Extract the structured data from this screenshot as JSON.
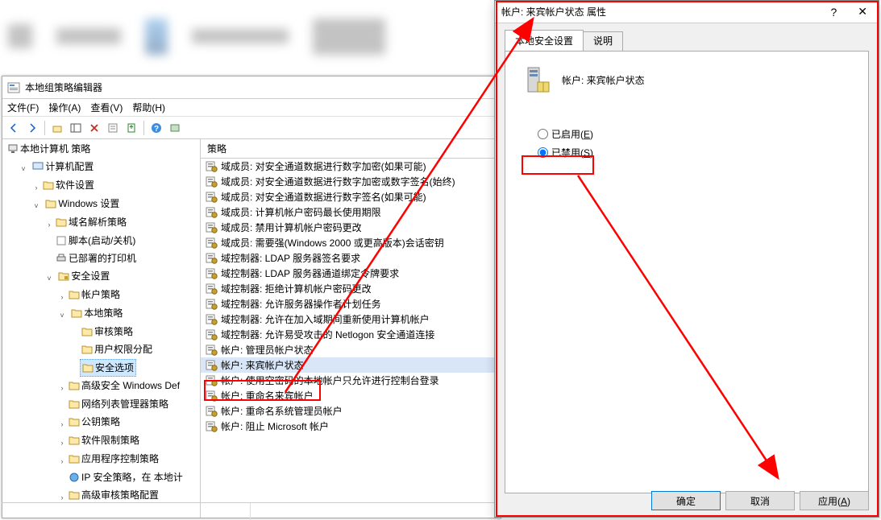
{
  "bg": {},
  "gpedit": {
    "title": "本地组策略编辑器",
    "menu": {
      "file": "文件(F)",
      "action": "操作(A)",
      "view": "查看(V)",
      "help": "帮助(H)"
    },
    "tree": {
      "root": "本地计算机 策略",
      "computer_config": "计算机配置",
      "software_settings": "软件设置",
      "windows_settings": "Windows 设置",
      "name_resolution": "域名解析策略",
      "scripts": "脚本(启动/关机)",
      "deployed_printers": "已部署的打印机",
      "security_settings": "安全设置",
      "account_policies": "帐户策略",
      "local_policies": "本地策略",
      "audit_policy": "审核策略",
      "user_rights": "用户权限分配",
      "security_options": "安全选项",
      "advanced_firewall": "高级安全 Windows Def",
      "network_list": "网络列表管理器策略",
      "public_key": "公钥策略",
      "software_restriction": "软件限制策略",
      "app_control": "应用程序控制策略",
      "ip_security": "IP 安全策略，在 本地计",
      "advanced_audit": "高级审核策略配置"
    },
    "list": {
      "header": "策略",
      "items": [
        "域成员: 对安全通道数据进行数字加密(如果可能)",
        "域成员: 对安全通道数据进行数字加密或数字签名(始终)",
        "域成员: 对安全通道数据进行数字签名(如果可能)",
        "域成员: 计算机帐户密码最长使用期限",
        "域成员: 禁用计算机帐户密码更改",
        "域成员: 需要强(Windows 2000 或更高版本)会话密钥",
        "域控制器: LDAP 服务器签名要求",
        "域控制器: LDAP 服务器通道绑定令牌要求",
        "域控制器: 拒绝计算机帐户密码更改",
        "域控制器: 允许服务器操作者计划任务",
        "域控制器:   允许在加入域期间重新使用计算机帐户",
        "域控制器: 允许易受攻击的 Netlogon 安全通道连接",
        "帐户: 管理员帐户状态",
        "帐户: 来宾帐户状态",
        "帐户: 使用空密码的本地帐户只允许进行控制台登录",
        "帐户: 重命名来宾帐户",
        "帐户: 重命名系统管理员帐户",
        "帐户: 阻止 Microsoft 帐户"
      ]
    }
  },
  "dialog": {
    "title": "帐户: 来宾帐户状态 属性",
    "tab_local": "本地安全设置",
    "tab_explain": "说明",
    "policy_name": "帐户: 来宾帐户状态",
    "enabled_label": "已启用(E)",
    "disabled_label": "已禁用(S)",
    "btn_ok": "确定",
    "btn_cancel": "取消",
    "btn_apply": "应用(A)"
  }
}
